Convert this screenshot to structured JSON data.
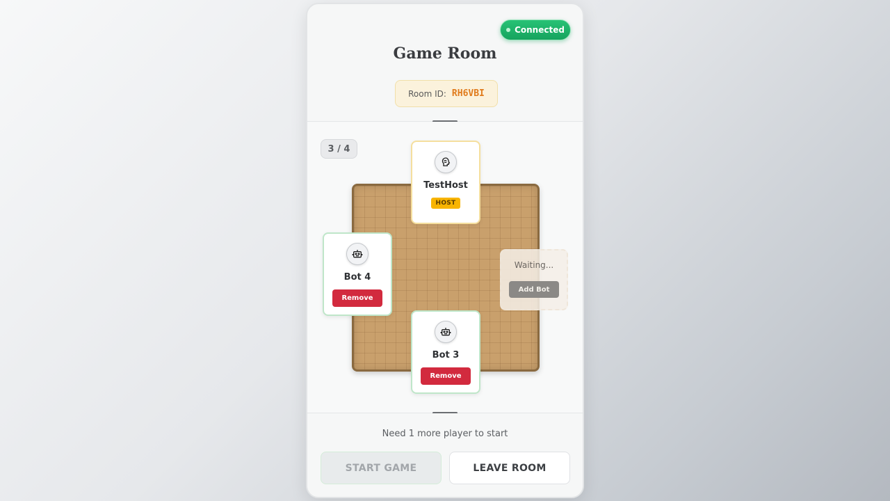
{
  "header": {
    "status": "Connected",
    "title": "Game Room",
    "room_id_label": "Room ID:",
    "room_id": "RH6VBI"
  },
  "board": {
    "player_count": "3 / 4",
    "players": [
      {
        "name": "TestHost",
        "role": "HOST",
        "icon": "brain-icon",
        "seat": "top"
      },
      {
        "name": "Bot 4",
        "action": "Remove",
        "icon": "robot-icon",
        "seat": "left"
      },
      {
        "name": "Bot 3",
        "action": "Remove",
        "icon": "robot-icon",
        "seat": "bottom"
      }
    ],
    "waiting_slot": {
      "label": "Waiting...",
      "action": "Add Bot",
      "seat": "right"
    }
  },
  "footer": {
    "status_text": "Need 1 more player to start",
    "start_label": "START GAME",
    "leave_label": "LEAVE ROOM"
  },
  "colors": {
    "connected": "#1fb36a",
    "host_badge": "#f8b400",
    "remove": "#d22a3e",
    "room_id": "#e07b1c",
    "board": "#c9a06c"
  }
}
